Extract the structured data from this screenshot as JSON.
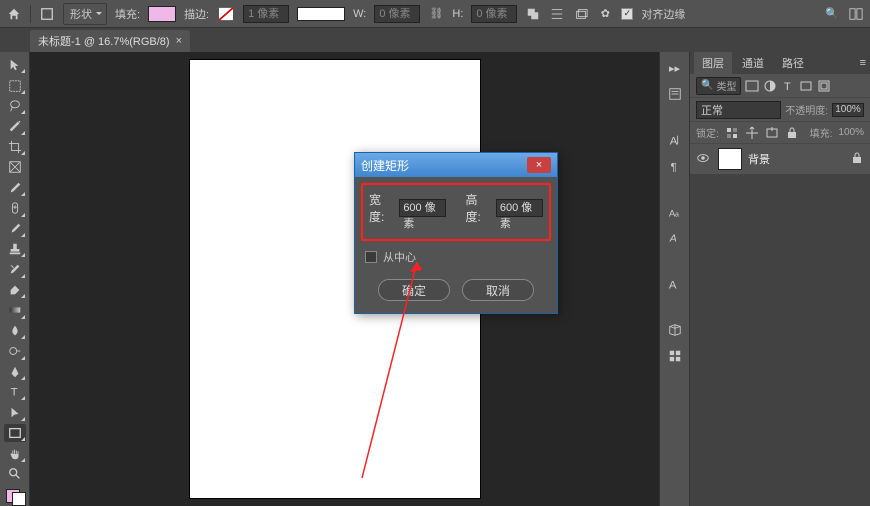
{
  "topbar": {
    "shape_label": "形状",
    "fill_label": "填充:",
    "stroke_label": "描边:",
    "stroke_width": "1 像素",
    "w_label": "W:",
    "w_value": "0 像素",
    "h_label": "H:",
    "h_value": "0 像素",
    "align_label": "对齐边缘"
  },
  "tab": {
    "title": "未标题-1 @ 16.7%(RGB/8)",
    "close": "×"
  },
  "dialog": {
    "title": "创建矩形",
    "width_label": "宽度:",
    "width_value": "600 像素",
    "height_label": "高度:",
    "height_value": "600 像素",
    "center_label": "从中心",
    "ok": "确定",
    "cancel": "取消",
    "close": "×"
  },
  "panels": {
    "tabs": {
      "layers": "图层",
      "channels": "通道",
      "paths": "路径"
    },
    "filter_placeholder": "类型",
    "blend_mode": "正常",
    "opacity_label": "不透明度:",
    "opacity_value": "100%",
    "lock_label": "锁定:",
    "fill_label": "填充:",
    "fill_value": "100%",
    "layer1_name": "背景"
  },
  "icons": {
    "search": "🔍",
    "home": "⌂",
    "gear": "⚙",
    "chain": "⛓",
    "eye": "👁"
  }
}
